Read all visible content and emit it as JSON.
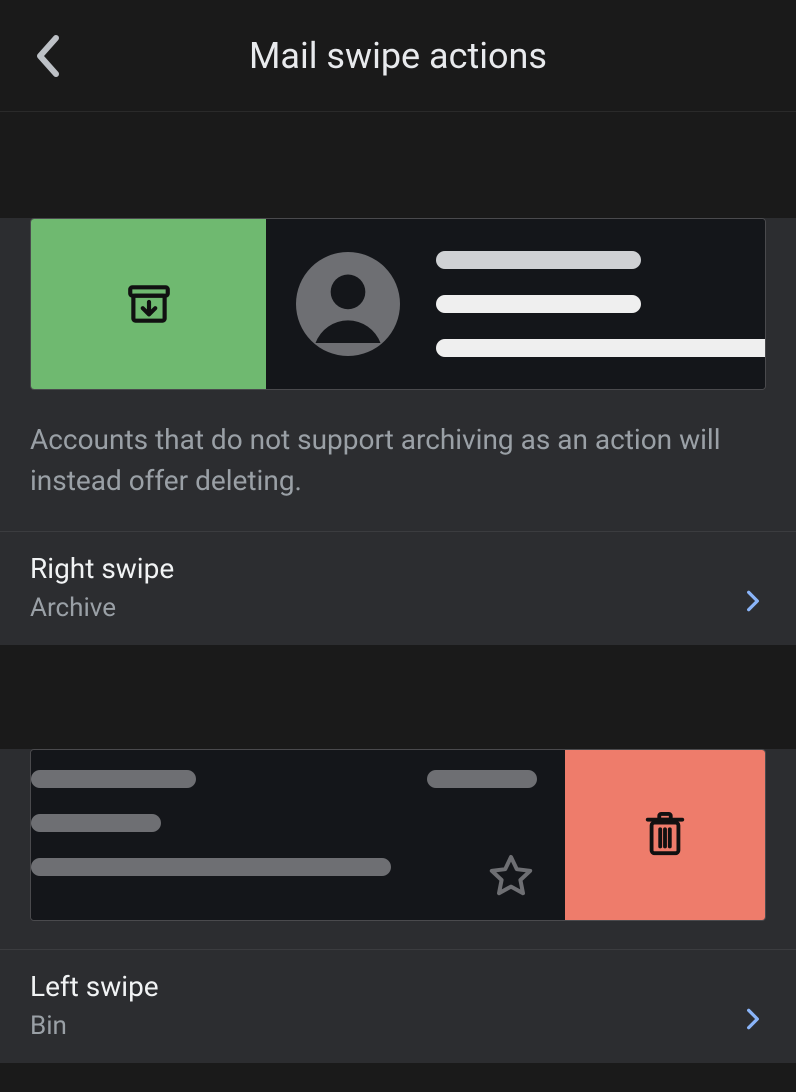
{
  "header": {
    "title": "Mail swipe actions"
  },
  "right": {
    "description": "Accounts that do not support archiving as an action will instead offer deleting.",
    "option_label": "Right swipe",
    "option_value": "Archive"
  },
  "left": {
    "option_label": "Left swipe",
    "option_value": "Bin"
  },
  "icons": {
    "back": "chevron-left-icon",
    "archive": "archive-icon",
    "trash": "trash-icon",
    "star": "star-outline-icon",
    "disclosure": "chevron-right-icon"
  },
  "colors": {
    "archive_bg": "#6fb970",
    "delete_bg": "#ee7c6b"
  }
}
